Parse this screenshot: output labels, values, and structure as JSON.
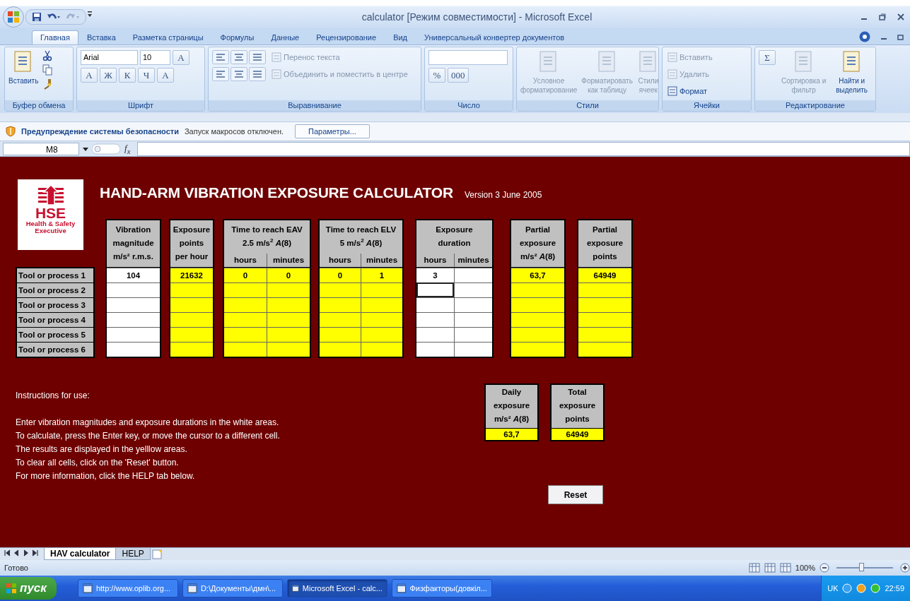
{
  "title_bar": {
    "title": "calculator  [Режим совместимости] - Microsoft Excel"
  },
  "ribbon": {
    "tabs": [
      {
        "label": "Главная",
        "selected": true
      },
      {
        "label": "Вставка",
        "selected": false
      },
      {
        "label": "Разметка страницы",
        "selected": false
      },
      {
        "label": "Формулы",
        "selected": false
      },
      {
        "label": "Данные",
        "selected": false
      },
      {
        "label": "Рецензирование",
        "selected": false
      },
      {
        "label": "Вид",
        "selected": false
      },
      {
        "label": "Универсальный конвертер документов",
        "selected": false
      }
    ],
    "groups": [
      {
        "label": "Буфер обмена",
        "items": [
          {
            "kind": "large",
            "label": "Вставить",
            "disabled": false
          }
        ]
      },
      {
        "label": "Шрифт",
        "items": [
          {
            "kind": "combo",
            "label": "Arial",
            "disabled": false
          },
          {
            "kind": "combo",
            "label": "10",
            "disabled": false
          },
          {
            "kind": "glyph",
            "label": "A",
            "disabled": false
          },
          {
            "kind": "glyph",
            "label": "A",
            "disabled": false
          },
          {
            "kind": "glyph",
            "label": "Ж",
            "disabled": false
          },
          {
            "kind": "glyph",
            "label": "К",
            "disabled": false
          },
          {
            "kind": "glyph",
            "label": "Ч",
            "disabled": false
          },
          {
            "kind": "glyph",
            "label": "A",
            "disabled": false
          }
        ]
      },
      {
        "label": "Выравнивание",
        "items": [
          {
            "kind": "small",
            "label": "Перенос текста",
            "disabled": true
          },
          {
            "kind": "small",
            "label": "Объединить и поместить в центре",
            "disabled": true
          }
        ]
      },
      {
        "label": "Число",
        "items": [
          {
            "kind": "glyph",
            "label": "%",
            "disabled": false
          },
          {
            "kind": "glyph",
            "label": "000",
            "disabled": false
          }
        ]
      },
      {
        "label": "Стили",
        "items": [
          {
            "kind": "large",
            "label": "Условное форматирование",
            "disabled": true
          },
          {
            "kind": "large",
            "label": "Форматировать как таблицу",
            "disabled": true
          },
          {
            "kind": "large",
            "label": "Стили ячеек",
            "disabled": true
          }
        ]
      },
      {
        "label": "Ячейки",
        "items": [
          {
            "kind": "small",
            "label": "Вставить",
            "disabled": true
          },
          {
            "kind": "small",
            "label": "Удалить",
            "disabled": true
          },
          {
            "kind": "small",
            "label": "Формат",
            "disabled": false
          }
        ]
      },
      {
        "label": "Редактирование",
        "items": [
          {
            "kind": "glyph",
            "label": "Σ",
            "disabled": false
          },
          {
            "kind": "large",
            "label": "Сортировка и фильтр",
            "disabled": true
          },
          {
            "kind": "large",
            "label": "Найти и выделить",
            "disabled": false
          }
        ]
      }
    ]
  },
  "security_bar": {
    "title": "Предупреждение системы безопасности",
    "message": "Запуск макросов отключен.",
    "button": "Параметры..."
  },
  "formula_bar": {
    "name_box": "M8",
    "function_button": "f$_{x}$"
  },
  "sheet": {
    "title": "HAND-ARM VIBRATION EXPOSURE CALCULATOR",
    "version": "Version 3  June 2005",
    "logo": {
      "acronym": "HSE",
      "name": "Health & Safety Executive"
    },
    "column_groups": [
      {
        "kind": "input",
        "lines": [
          "Vibration",
          "magnitude",
          "m/s² r.m.s."
        ]
      },
      {
        "kind": "result",
        "lines": [
          "Exposure",
          "points",
          "per hour"
        ]
      },
      {
        "kind": "result",
        "lines": [
          "Time to reach EAV",
          "2.5 m/s$^{2}$ *A*(8)"
        ],
        "subcolumns": [
          "hours",
          "minutes"
        ]
      },
      {
        "kind": "result",
        "lines": [
          "Time to reach ELV",
          "5 m/s$^{2}$ *A*(8)"
        ],
        "subcolumns": [
          "hours",
          "minutes"
        ]
      },
      {
        "kind": "input",
        "lines": [
          "Exposure",
          "duration"
        ],
        "subcolumns": [
          "hours",
          "minutes"
        ]
      },
      {
        "kind": "result",
        "lines": [
          "Partial",
          "exposure",
          "m/s² *A*(8)"
        ]
      },
      {
        "kind": "result",
        "lines": [
          "Partial",
          "exposure",
          "points"
        ]
      }
    ],
    "rows": [
      {
        "label": "Tool or process 1",
        "cells": [
          {
            "value": "104",
            "selected": false
          },
          {
            "value": "21632",
            "selected": false
          },
          {
            "value": "0",
            "selected": false
          },
          {
            "value": "0",
            "selected": false
          },
          {
            "value": "0",
            "selected": false
          },
          {
            "value": "1",
            "selected": false
          },
          {
            "value": "3",
            "selected": false
          },
          {
            "selected": false
          },
          {
            "value": "63,7",
            "selected": false
          },
          {
            "value": "64949",
            "selected": false
          }
        ]
      },
      {
        "label": "Tool or process 2",
        "cells": [
          {
            "selected": false
          },
          {
            "selected": false
          },
          {
            "selected": false
          },
          {
            "selected": false
          },
          {
            "selected": false
          },
          {
            "selected": false
          },
          {
            "selected": true
          },
          {
            "selected": false
          },
          {
            "selected": false
          },
          {
            "selected": false
          }
        ]
      },
      {
        "label": "Tool or process 3",
        "cells": [
          {
            "selected": false
          },
          {
            "selected": false
          },
          {
            "selected": false
          },
          {
            "selected": false
          },
          {
            "selected": false
          },
          {
            "selected": false
          },
          {
            "selected": false
          },
          {
            "selected": false
          },
          {
            "selected": false
          },
          {
            "selected": false
          }
        ]
      },
      {
        "label": "Tool or process 4",
        "cells": [
          {
            "selected": false
          },
          {
            "selected": false
          },
          {
            "selected": false
          },
          {
            "selected": false
          },
          {
            "selected": false
          },
          {
            "selected": false
          },
          {
            "selected": false
          },
          {
            "selected": false
          },
          {
            "selected": false
          },
          {
            "selected": false
          }
        ]
      },
      {
        "label": "Tool or process 5",
        "cells": [
          {
            "selected": false
          },
          {
            "selected": false
          },
          {
            "selected": false
          },
          {
            "selected": false
          },
          {
            "selected": false
          },
          {
            "selected": false
          },
          {
            "selected": false
          },
          {
            "selected": false
          },
          {
            "selected": false
          },
          {
            "selected": false
          }
        ]
      },
      {
        "label": "Tool or process 6",
        "cells": [
          {
            "selected": false
          },
          {
            "selected": false
          },
          {
            "selected": false
          },
          {
            "selected": false
          },
          {
            "selected": false
          },
          {
            "selected": false
          },
          {
            "selected": false
          },
          {
            "selected": false
          },
          {
            "selected": false
          },
          {
            "selected": false
          }
        ]
      }
    ],
    "totals": [
      {
        "lines": [
          "Daily",
          "exposure",
          "m/s² *A*(8)"
        ],
        "value": "63,7"
      },
      {
        "lines": [
          "Total",
          "exposure",
          "points"
        ],
        "value": "64949"
      }
    ],
    "instructions": [
      "Instructions for use:",
      "Enter vibration magnitudes and exposure durations in the white areas.",
      "To calculate, press the Enter key, or move the cursor to a different cell.",
      "The results are displayed in the yelllow areas.",
      "To clear all cells, click on the 'Reset' button.",
      "For more information, click the HELP tab below."
    ],
    "reset_button": "Reset"
  },
  "sheet_tabs": [
    {
      "label": "HAV calculator",
      "selected": true
    },
    {
      "label": "HELP",
      "selected": false
    }
  ],
  "status_bar": {
    "status": "Готово",
    "zoom": "100%",
    "zoom_slider": {
      "level": 0.45
    }
  },
  "taskbar": {
    "start": "пуск",
    "windows": [
      {
        "label": "http://www.oplib.org...",
        "selected": false
      },
      {
        "label": "D:\\Документы\\дмн\\...",
        "selected": false
      },
      {
        "label": "Microsoft Excel - calc...",
        "selected": true
      },
      {
        "label": "Физфакторы(довкіл...",
        "selected": false
      }
    ],
    "language": "UK",
    "clock": "22:59"
  }
}
